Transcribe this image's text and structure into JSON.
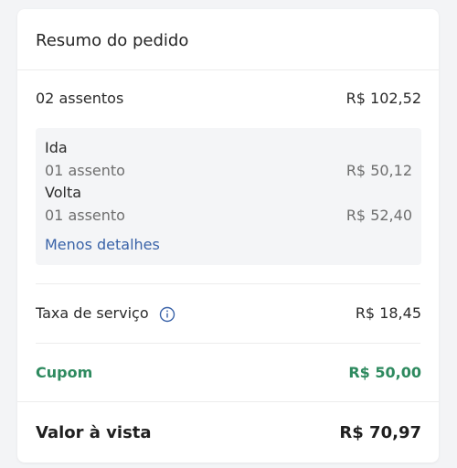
{
  "summary": {
    "title": "Resumo do pedido",
    "seats": {
      "label": "02 assentos",
      "value": "R$ 102,52"
    },
    "details": {
      "legs": [
        {
          "title": "Ida",
          "seats_label": "01 assento",
          "price": "R$ 50,12"
        },
        {
          "title": "Volta",
          "seats_label": "01 assento",
          "price": "R$ 52,40"
        }
      ],
      "toggle_label": "Menos detalhes"
    },
    "service_fee": {
      "label": "Taxa de serviço",
      "value": "R$ 18,45",
      "icon": "info-icon"
    },
    "coupon": {
      "label": "Cupom",
      "value": "R$ 50,00"
    },
    "total": {
      "label": "Valor à vista",
      "value": "R$ 70,97"
    }
  },
  "colors": {
    "link": "#3a63a8",
    "coupon": "#2e8a5f",
    "details_background": "#f4f5f7"
  }
}
